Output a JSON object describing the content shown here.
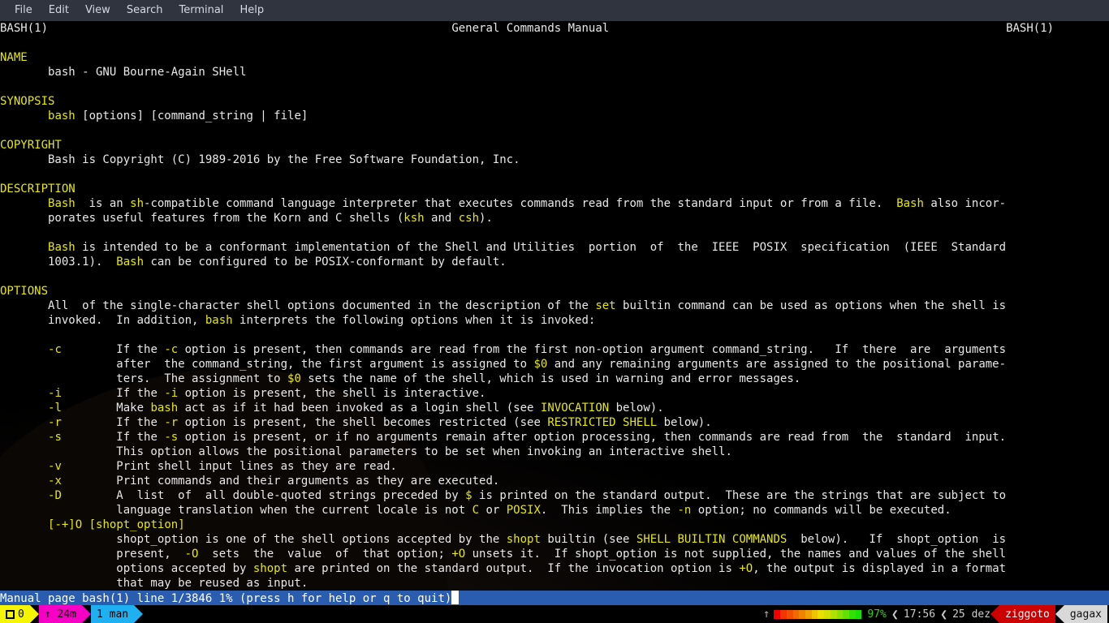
{
  "menubar": {
    "items": [
      {
        "label": "File",
        "name": "menu-file"
      },
      {
        "label": "Edit",
        "name": "menu-edit"
      },
      {
        "label": "View",
        "name": "menu-view"
      },
      {
        "label": "Search",
        "name": "menu-search"
      },
      {
        "label": "Terminal",
        "name": "menu-terminal"
      },
      {
        "label": "Help",
        "name": "menu-help"
      }
    ]
  },
  "manpage": {
    "header_left": "BASH(1)",
    "header_center": "General Commands Manual",
    "header_right": "BASH(1)",
    "lines": [
      [
        {
          "t": "BASH(1)",
          "c": "plain"
        },
        {
          "t": "                                                           ",
          "c": "plain"
        },
        {
          "t": "General Commands Manual",
          "c": "plain"
        },
        {
          "t": "                                                          ",
          "c": "plain"
        },
        {
          "t": "BASH(1)",
          "c": "plain"
        }
      ],
      [],
      [
        {
          "t": "NAME",
          "c": "bold"
        }
      ],
      [
        {
          "t": "       bash - GNU Bourne-Again SHell",
          "c": "plain"
        }
      ],
      [],
      [
        {
          "t": "SYNOPSIS",
          "c": "bold"
        }
      ],
      [
        {
          "t": "       ",
          "c": "plain"
        },
        {
          "t": "bash",
          "c": "bold"
        },
        {
          "t": " [options] [command_string | file]",
          "c": "plain"
        }
      ],
      [],
      [
        {
          "t": "COPYRIGHT",
          "c": "bold"
        }
      ],
      [
        {
          "t": "       Bash is Copyright (C) 1989-2016 by the Free Software Foundation, Inc.",
          "c": "plain"
        }
      ],
      [],
      [
        {
          "t": "DESCRIPTION",
          "c": "bold"
        }
      ],
      [
        {
          "t": "       ",
          "c": "plain"
        },
        {
          "t": "Bash",
          "c": "bold"
        },
        {
          "t": "  is an ",
          "c": "plain"
        },
        {
          "t": "sh",
          "c": "bold"
        },
        {
          "t": "-compatible command language interpreter that executes commands read from the standard input or from a file.  ",
          "c": "plain"
        },
        {
          "t": "Bash",
          "c": "bold"
        },
        {
          "t": " also incor-",
          "c": "plain"
        }
      ],
      [
        {
          "t": "       porates useful features from the Korn and C shells (",
          "c": "plain"
        },
        {
          "t": "ksh",
          "c": "bold"
        },
        {
          "t": " and ",
          "c": "plain"
        },
        {
          "t": "csh",
          "c": "bold"
        },
        {
          "t": ").",
          "c": "plain"
        }
      ],
      [],
      [
        {
          "t": "       ",
          "c": "plain"
        },
        {
          "t": "Bash",
          "c": "bold"
        },
        {
          "t": " is intended to be a conformant implementation of the Shell and Utilities  portion  of  the  IEEE  POSIX  specification  (IEEE  Standard",
          "c": "plain"
        }
      ],
      [
        {
          "t": "       1003.1).  ",
          "c": "plain"
        },
        {
          "t": "Bash",
          "c": "bold"
        },
        {
          "t": " can be configured to be POSIX-conformant by default.",
          "c": "plain"
        }
      ],
      [],
      [
        {
          "t": "OPTIONS",
          "c": "bold"
        }
      ],
      [
        {
          "t": "       All  of the single-character shell options documented in the description of the ",
          "c": "plain"
        },
        {
          "t": "set",
          "c": "bold"
        },
        {
          "t": " builtin command can be used as options when the shell is",
          "c": "plain"
        }
      ],
      [
        {
          "t": "       invoked.  In addition, ",
          "c": "plain"
        },
        {
          "t": "bash",
          "c": "bold"
        },
        {
          "t": " interprets the following options when it is invoked:",
          "c": "plain"
        }
      ],
      [],
      [
        {
          "t": "       ",
          "c": "plain"
        },
        {
          "t": "-c",
          "c": "bold"
        },
        {
          "t": "        If the ",
          "c": "plain"
        },
        {
          "t": "-c",
          "c": "bold"
        },
        {
          "t": " option is present, then commands are read from the first non-option argument command_string.   If  there  are  arguments",
          "c": "plain"
        }
      ],
      [
        {
          "t": "                 after  the command_string, the first argument is assigned to ",
          "c": "plain"
        },
        {
          "t": "$0",
          "c": "bold"
        },
        {
          "t": " and any remaining arguments are assigned to the positional parame-",
          "c": "plain"
        }
      ],
      [
        {
          "t": "                 ters.  The assignment to ",
          "c": "plain"
        },
        {
          "t": "$0",
          "c": "bold"
        },
        {
          "t": " sets the name of the shell, which is used in warning and error messages.",
          "c": "plain"
        }
      ],
      [
        {
          "t": "       ",
          "c": "plain"
        },
        {
          "t": "-i",
          "c": "bold"
        },
        {
          "t": "        If the ",
          "c": "plain"
        },
        {
          "t": "-i",
          "c": "bold"
        },
        {
          "t": " option is present, the shell is interactive.",
          "c": "plain"
        }
      ],
      [
        {
          "t": "       ",
          "c": "plain"
        },
        {
          "t": "-l",
          "c": "bold"
        },
        {
          "t": "        Make ",
          "c": "plain"
        },
        {
          "t": "bash",
          "c": "bold"
        },
        {
          "t": " act as if it had been invoked as a login shell (see ",
          "c": "plain"
        },
        {
          "t": "INVOCATION",
          "c": "uline"
        },
        {
          "t": " below).",
          "c": "plain"
        }
      ],
      [
        {
          "t": "       ",
          "c": "plain"
        },
        {
          "t": "-r",
          "c": "bold"
        },
        {
          "t": "        If the ",
          "c": "plain"
        },
        {
          "t": "-r",
          "c": "bold"
        },
        {
          "t": " option is present, the shell becomes restricted (see ",
          "c": "plain"
        },
        {
          "t": "RESTRICTED SHELL",
          "c": "uline"
        },
        {
          "t": " below).",
          "c": "plain"
        }
      ],
      [
        {
          "t": "       ",
          "c": "plain"
        },
        {
          "t": "-s",
          "c": "bold"
        },
        {
          "t": "        If the ",
          "c": "plain"
        },
        {
          "t": "-s",
          "c": "bold"
        },
        {
          "t": " option is present, or if no arguments remain after option processing, then commands are read from  the  standard  input.",
          "c": "plain"
        }
      ],
      [
        {
          "t": "                 This option allows the positional parameters to be set when invoking an interactive shell.",
          "c": "plain"
        }
      ],
      [
        {
          "t": "       ",
          "c": "plain"
        },
        {
          "t": "-v",
          "c": "bold"
        },
        {
          "t": "        Print shell input lines as they are read.",
          "c": "plain"
        }
      ],
      [
        {
          "t": "       ",
          "c": "plain"
        },
        {
          "t": "-x",
          "c": "bold"
        },
        {
          "t": "        Print commands and their arguments as they are executed.",
          "c": "plain"
        }
      ],
      [
        {
          "t": "       ",
          "c": "plain"
        },
        {
          "t": "-D",
          "c": "bold"
        },
        {
          "t": "        A  list  of  all double-quoted strings preceded by ",
          "c": "plain"
        },
        {
          "t": "$",
          "c": "bold"
        },
        {
          "t": " is printed on the standard output.  These are the strings that are subject to",
          "c": "plain"
        }
      ],
      [
        {
          "t": "                 language translation when the current locale is not ",
          "c": "plain"
        },
        {
          "t": "C",
          "c": "bold"
        },
        {
          "t": " or ",
          "c": "plain"
        },
        {
          "t": "POSIX",
          "c": "bold"
        },
        {
          "t": ".  This implies the ",
          "c": "plain"
        },
        {
          "t": "-n",
          "c": "bold"
        },
        {
          "t": " option; no commands will be executed.",
          "c": "plain"
        }
      ],
      [
        {
          "t": "       ",
          "c": "plain"
        },
        {
          "t": "[-+]O [",
          "c": "bold"
        },
        {
          "t": "shopt_option",
          "c": "uline"
        },
        {
          "t": "]",
          "c": "bold"
        }
      ],
      [
        {
          "t": "                 shopt_option is one of the shell options accepted by the ",
          "c": "plain"
        },
        {
          "t": "shopt",
          "c": "bold"
        },
        {
          "t": " builtin (see ",
          "c": "plain"
        },
        {
          "t": "SHELL BUILTIN COMMANDS",
          "c": "uline"
        },
        {
          "t": "  below).   If  shopt_option  is",
          "c": "plain"
        }
      ],
      [
        {
          "t": "                 present,  ",
          "c": "plain"
        },
        {
          "t": "-O",
          "c": "bold"
        },
        {
          "t": "  sets  the  value  of  that option; ",
          "c": "plain"
        },
        {
          "t": "+O",
          "c": "bold"
        },
        {
          "t": " unsets it.  If shopt_option is not supplied, the names and values of the shell",
          "c": "plain"
        }
      ],
      [
        {
          "t": "                 options accepted by ",
          "c": "plain"
        },
        {
          "t": "shopt",
          "c": "bold"
        },
        {
          "t": " are printed on the standard output.  If the invocation option is ",
          "c": "plain"
        },
        {
          "t": "+O",
          "c": "bold"
        },
        {
          "t": ", the output is displayed in a format",
          "c": "plain"
        }
      ],
      [
        {
          "t": "                 that may be reused as input.",
          "c": "plain"
        }
      ]
    ]
  },
  "statusline": {
    "text": "Manual page bash(1) line 1/3846 1% (press h for help or q to quit)"
  },
  "powerline": {
    "left": [
      {
        "name": "window-count-segment",
        "icon": "square-icon",
        "label": "0",
        "style": "yellow"
      },
      {
        "name": "uptime-segment",
        "icon": "up-arrow-icon",
        "label": "↑ 24m",
        "style": "magenta"
      },
      {
        "name": "tmux-window-man",
        "label": "1 man",
        "style": "cyan"
      }
    ],
    "right": {
      "battery_icon": "↑",
      "battery_pct": "97%",
      "separator": "❮",
      "time": "17:56",
      "date": "25 dez",
      "hostname": "ziggoto",
      "user": "gagax"
    }
  },
  "colors": {
    "menubar_bg": "#2f343f",
    "terminal_bg": "#000000",
    "bold_fg": "#e8e800",
    "plain_fg": "#e8e8e8",
    "status_bg": "#2a5db0",
    "seg_yellow": "#f5f500",
    "seg_magenta": "#f500c4",
    "seg_cyan": "#1eb0f0",
    "seg_red": "#cc0000",
    "seg_grey": "#d8d8d8",
    "battery_pct_fg": "#33d017"
  }
}
